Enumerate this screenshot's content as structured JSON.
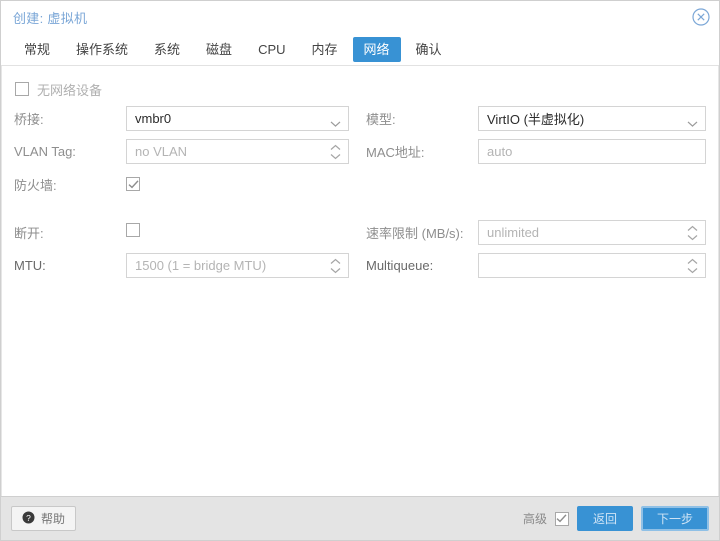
{
  "header": {
    "title": "创建: 虚拟机",
    "close_icon": "close-circle-icon"
  },
  "tabs": [
    {
      "label": "常规",
      "active": false
    },
    {
      "label": "操作系统",
      "active": false
    },
    {
      "label": "系统",
      "active": false
    },
    {
      "label": "磁盘",
      "active": false
    },
    {
      "label": "CPU",
      "active": false
    },
    {
      "label": "内存",
      "active": false
    },
    {
      "label": "网络",
      "active": true
    },
    {
      "label": "确认",
      "active": false
    }
  ],
  "form": {
    "no_network_device": {
      "label": "无网络设备",
      "checked": false
    },
    "left": [
      {
        "name": "bridge",
        "label": "桥接:",
        "value": "vmbr0",
        "placeholder": "",
        "control": "combo"
      },
      {
        "name": "vlan-tag",
        "label": "VLAN Tag:",
        "value": "",
        "placeholder": "no VLAN",
        "control": "spinner"
      },
      {
        "name": "firewall",
        "label": "防火墙:",
        "value": "",
        "placeholder": "",
        "control": "checkbox",
        "checked": true
      }
    ],
    "right": [
      {
        "name": "model",
        "label": "模型:",
        "value": "VirtIO (半虚拟化)",
        "placeholder": "",
        "control": "combo"
      },
      {
        "name": "mac-address",
        "label": "MAC地址:",
        "value": "",
        "placeholder": "auto",
        "control": "text"
      }
    ],
    "left_advanced": [
      {
        "name": "disconnect",
        "label": "断开:",
        "value": "",
        "placeholder": "",
        "control": "checkbox",
        "checked": false
      },
      {
        "name": "mtu",
        "label": "MTU:",
        "value": "",
        "placeholder": "1500 (1 = bridge MTU)",
        "control": "spinner"
      }
    ],
    "right_advanced": [
      {
        "name": "rate-limit",
        "label": "速率限制 (MB/s):",
        "value": "",
        "placeholder": "unlimited",
        "control": "spinner"
      },
      {
        "name": "multiqueue",
        "label": "Multiqueue:",
        "value": "",
        "placeholder": "",
        "control": "spinner"
      }
    ]
  },
  "footer": {
    "help_label": "帮助",
    "help_icon": "question-circle-icon",
    "advanced_label": "高级",
    "advanced_checked": true,
    "back_label": "返回",
    "next_label": "下一步"
  },
  "colors": {
    "accent": "#3892d4",
    "title": "#7ba7d7",
    "footer_bg": "#e4e4e4",
    "field_border": "#d4d4d4",
    "label": "#8e8e8e"
  }
}
